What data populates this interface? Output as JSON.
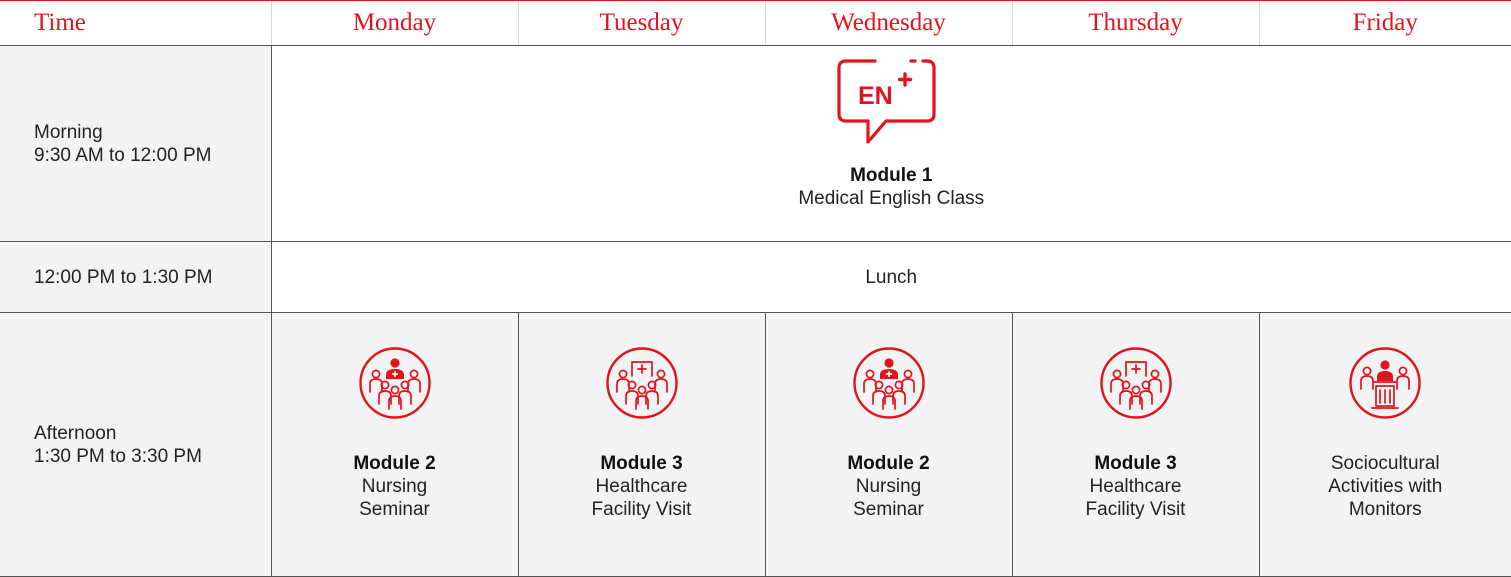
{
  "header": {
    "time": "Time",
    "days": [
      "Monday",
      "Tuesday",
      "Wednesday",
      "Thursday",
      "Friday"
    ]
  },
  "rows": {
    "morning": {
      "time_line1": "Morning",
      "time_line2": "9:30 AM to 12:00 PM",
      "icon": "english-language-speech-bubble-icon",
      "icon_text": "EN",
      "module": "Module 1",
      "title": "Medical English Class"
    },
    "lunch": {
      "time": "12:00 PM to 1:30 PM",
      "label": "Lunch"
    },
    "afternoon": {
      "time_line1": "Afternoon",
      "time_line2": "1:30 PM to 3:30 PM",
      "cells": [
        {
          "icon": "nursing-seminar-group-icon",
          "module": "Module 2",
          "title_line1": "Nursing",
          "title_line2": "Seminar"
        },
        {
          "icon": "healthcare-facility-group-icon",
          "module": "Module 3",
          "title_line1": "Healthcare",
          "title_line2": "Facility Visit"
        },
        {
          "icon": "nursing-seminar-group-icon",
          "module": "Module 2",
          "title_line1": "Nursing",
          "title_line2": "Seminar"
        },
        {
          "icon": "healthcare-facility-group-icon",
          "module": "Module 3",
          "title_line1": "Healthcare",
          "title_line2": "Facility Visit"
        },
        {
          "icon": "speaker-podium-icon",
          "text_line1": "Sociocultural",
          "text_line2": "Activities with",
          "text_line3": "Monitors"
        }
      ]
    }
  },
  "colors": {
    "accent": "#e0141e",
    "shaded_cell": "#f3f3f3",
    "text": "#222222",
    "rule": "#555555"
  }
}
